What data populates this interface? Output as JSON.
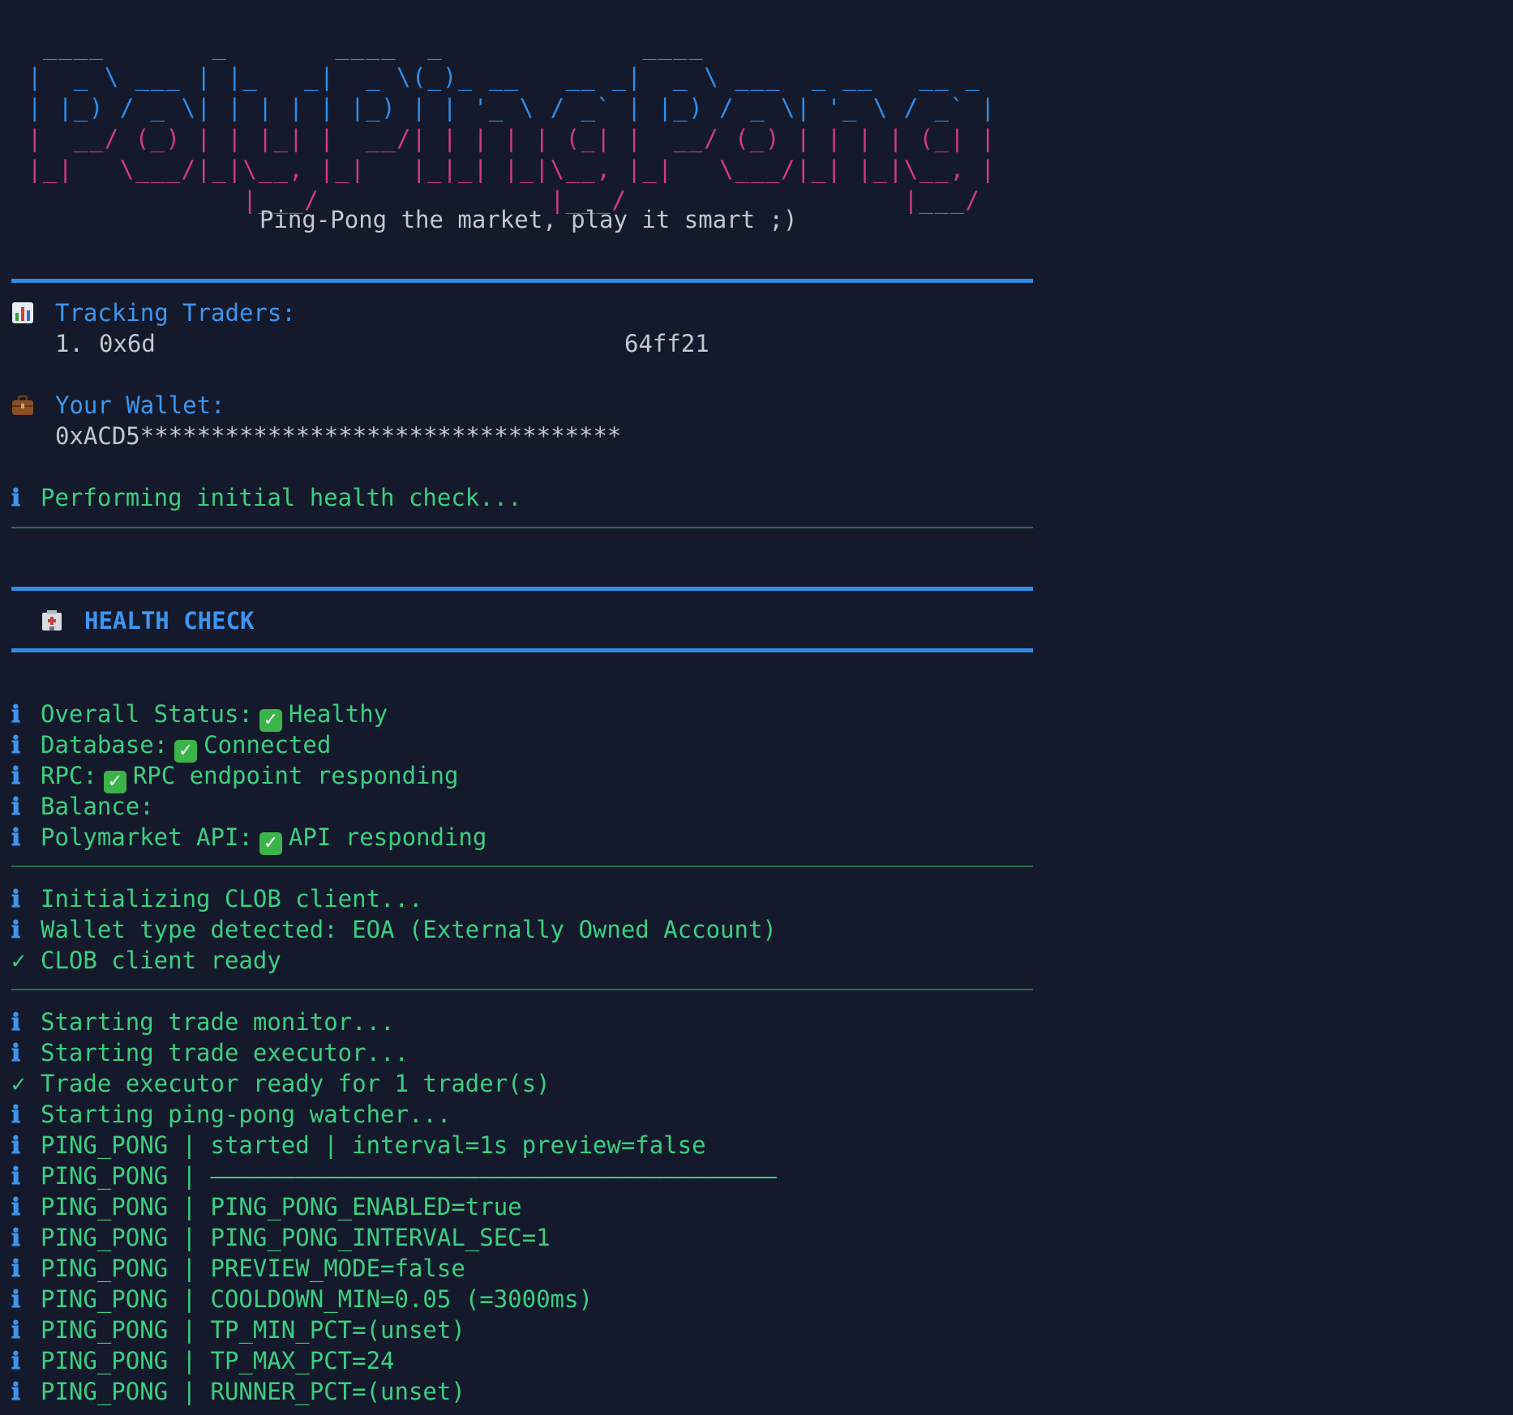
{
  "banner": {
    "ascii_lines": [
      " ____       _       ____  _             ____",
      "|  _ \\ ___ | |_   _|  _ \\(_)_ __   __ _|  _ \\ ___  _ __   __ _",
      "| |_) / _ \\| | | | | |_) | | '_ \\ / _` | |_) / _ \\| '_ \\ / _` |",
      "|  __/ (_) | | |_| |  __/| | | | | (_| |  __/ (_) | | | | (_| |",
      "|_|   \\___/|_|\\__, |_|   |_|_| |_|\\__, |_|   \\___/|_| |_|\\__, |",
      "              |___/               |___/                  |___/"
    ],
    "tagline": "Ping-Pong the market, play it smart ;)"
  },
  "tracking": {
    "icon": "bar-chart-icon",
    "title": "Tracking Traders:",
    "traders": [
      {
        "index": "1.",
        "address_start": "0x6d",
        "address_end": "64ff21"
      }
    ]
  },
  "wallet": {
    "icon": "briefcase-icon",
    "title": "Your Wallet:",
    "address": "0xACD5**********************************"
  },
  "initial_check": "Performing initial health check...",
  "health": {
    "icon": "hospital-icon",
    "title": "HEALTH CHECK",
    "items": [
      {
        "label": "Overall Status:",
        "check": "✓",
        "value": "Healthy"
      },
      {
        "label": "Database:",
        "check": "✓",
        "value": "Connected"
      },
      {
        "label": "RPC:",
        "check": "✓",
        "value": "RPC endpoint responding"
      },
      {
        "label": "Balance:",
        "check": "",
        "value": ""
      },
      {
        "label": "Polymarket API:",
        "check": "✓",
        "value": "API responding"
      }
    ]
  },
  "clob": [
    {
      "type": "info",
      "text": "Initializing CLOB client..."
    },
    {
      "type": "info",
      "text": "Wallet type detected: EOA (Externally Owned Account)"
    },
    {
      "type": "success",
      "text": "CLOB client ready"
    }
  ],
  "log": [
    {
      "type": "info",
      "text": "Starting trade monitor..."
    },
    {
      "type": "info",
      "text": "Starting trade executor..."
    },
    {
      "type": "success",
      "text": "Trade executor ready for 1 trader(s)"
    },
    {
      "type": "info",
      "text": "Starting ping-pong watcher..."
    },
    {
      "type": "info",
      "text": "PING_PONG | started | interval=1s preview=false"
    },
    {
      "type": "info",
      "text": "PING_PONG | ————————————————————————————————————————"
    },
    {
      "type": "info",
      "text": "PING_PONG | PING_PONG_ENABLED=true"
    },
    {
      "type": "info",
      "text": "PING_PONG | PING_PONG_INTERVAL_SEC=1"
    },
    {
      "type": "info",
      "text": "PING_PONG | PREVIEW_MODE=false"
    },
    {
      "type": "info",
      "text": "PING_PONG | COOLDOWN_MIN=0.05 (=3000ms)"
    },
    {
      "type": "info",
      "text": "PING_PONG | TP_MIN_PCT=(unset)"
    },
    {
      "type": "info",
      "text": "PING_PONG | TP_MAX_PCT=24"
    },
    {
      "type": "info",
      "text": "PING_PONG | RUNNER_PCT=(unset)"
    }
  ],
  "glyphs": {
    "info": "ℹ",
    "success": "✓"
  },
  "colors": {
    "background": "#141a2b",
    "accent_blue": "#2f8de8",
    "banner_pink": "#d13a83",
    "log_green": "#3bcf80",
    "rule_green": "#2a6b4a"
  }
}
